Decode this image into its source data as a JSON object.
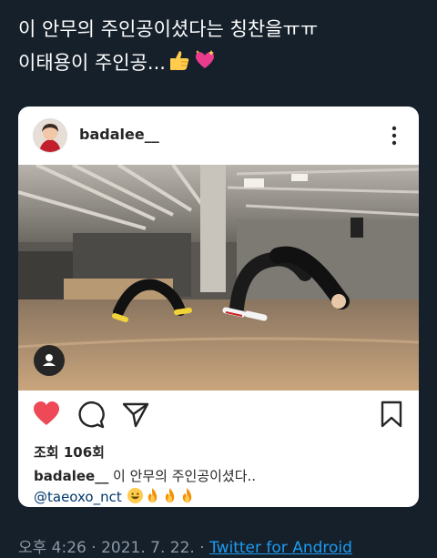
{
  "tweet": {
    "line1": "이 안무의 주인공이셨다는 칭찬을ㅠㅠ",
    "line2": "이태용이 주인공...",
    "emojis": [
      "thumbs-up",
      "sparkling-heart"
    ]
  },
  "instagram": {
    "username": "badalee__",
    "views_label": "조회 106회",
    "caption_user": "badalee__",
    "caption_text": "이 안무의 주인공이셨다..",
    "mention": "@taeoxo_nct",
    "caption_emojis": [
      "grinning-face",
      "fire",
      "fire",
      "fire"
    ],
    "liked": true,
    "colors": {
      "like": "#ed4956",
      "text": "#262626"
    }
  },
  "meta": {
    "time": "오후 4:26",
    "date": "2021. 7. 22.",
    "separator": "·",
    "source": "Twitter for Android"
  },
  "icons": [
    "more-icon",
    "user-tag-icon",
    "heart-icon",
    "comment-icon",
    "share-icon",
    "bookmark-icon"
  ]
}
